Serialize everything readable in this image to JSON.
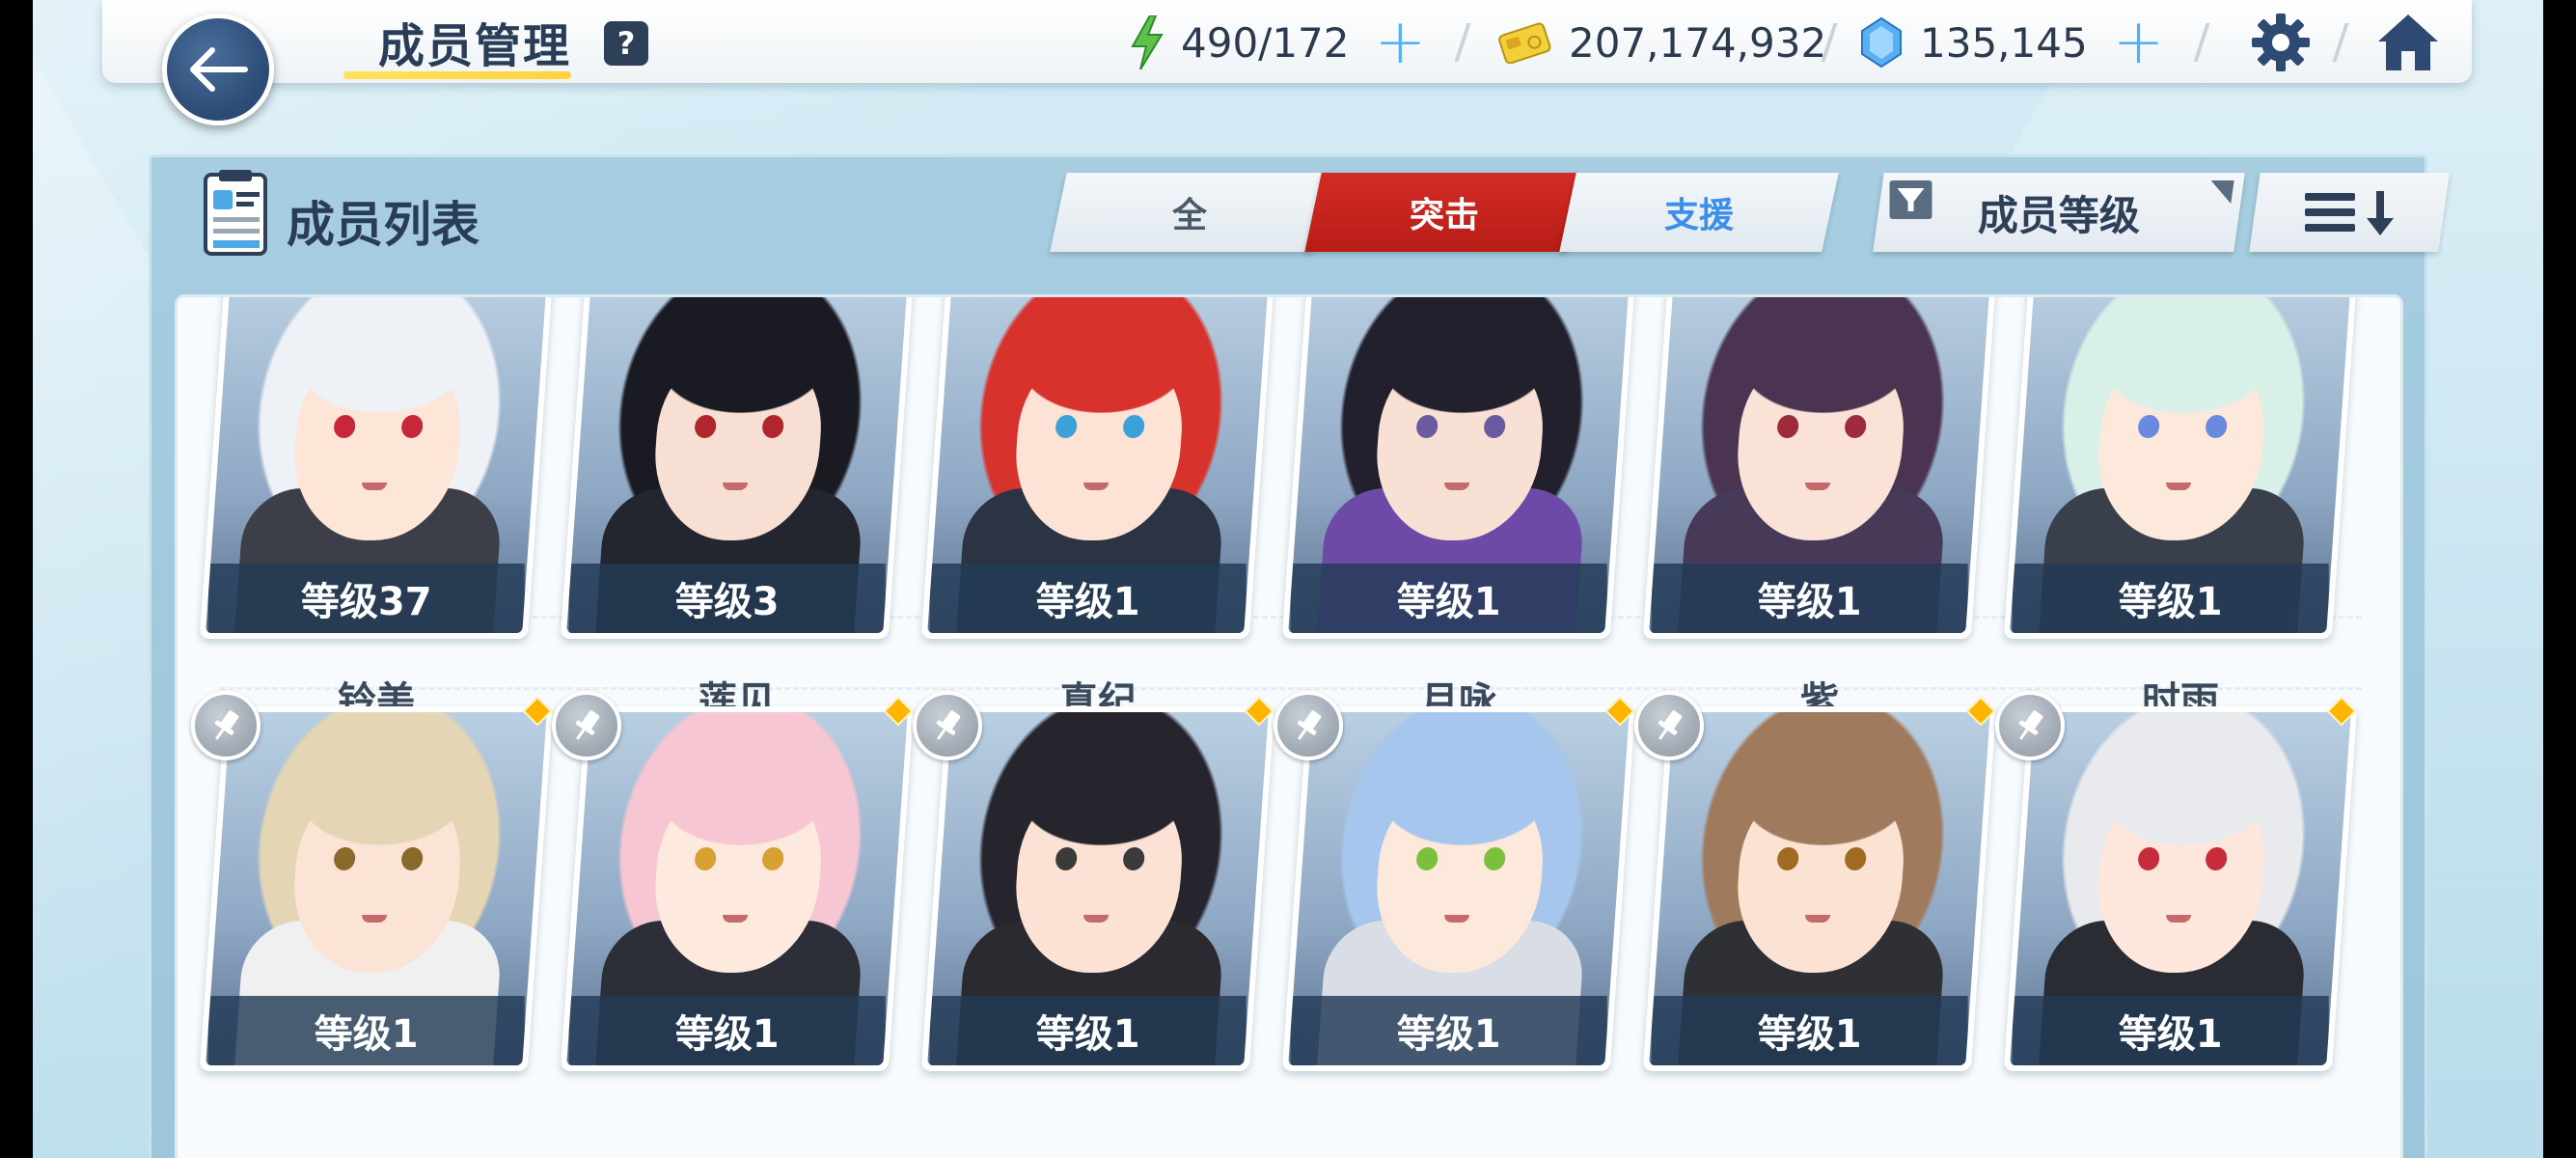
{
  "header": {
    "title": "成员管理",
    "help_label": "?",
    "ap": "490/172",
    "credits": "207,174,932",
    "gems": "135,145",
    "ap_plus": "+",
    "gems_plus": "+"
  },
  "panel": {
    "title": "成员列表",
    "tabs": [
      {
        "label": "全"
      },
      {
        "label": "突击"
      },
      {
        "label": "支援"
      }
    ],
    "sort_label": "成员等级"
  },
  "students": [
    {
      "name": "铃美",
      "level": "等级37",
      "hair": "#eef1f5",
      "skin": "#fde5d8",
      "eye": "#c8263a",
      "outfit": "#3c3f47"
    },
    {
      "name": "莲见",
      "level": "等级3",
      "hair": "#1a1a22",
      "skin": "#f8dfd3",
      "eye": "#b0262c",
      "outfit": "#23262e"
    },
    {
      "name": "真纪",
      "level": "等级1",
      "hair": "#d8322c",
      "skin": "#fde3d5",
      "eye": "#3aa2d8",
      "outfit": "#2c3444"
    },
    {
      "name": "月咏",
      "level": "等级1",
      "hair": "#22202c",
      "skin": "#f8e0d4",
      "eye": "#6a5aa0",
      "outfit": "#6e4aa8"
    },
    {
      "name": "紫",
      "level": "等级1",
      "hair": "#4a3452",
      "skin": "#fbe2d6",
      "eye": "#9c2c3c",
      "outfit": "#463a58"
    },
    {
      "name": "时雨",
      "level": "等级1",
      "hair": "#d8f0e8",
      "skin": "#fde8dc",
      "eye": "#6a8ae0",
      "outfit": "#3a3f4c"
    },
    {
      "name": "",
      "level": "等级1",
      "hair": "#e4d6b4",
      "skin": "#fbe4d6",
      "eye": "#8a6a2a",
      "outfit": "#f0f0f0"
    },
    {
      "name": "",
      "level": "等级1",
      "hair": "#f6c6d2",
      "skin": "#fde9dd",
      "eye": "#d8a030",
      "outfit": "#2c2f38"
    },
    {
      "name": "",
      "level": "等级1",
      "hair": "#26242c",
      "skin": "#fbe2d4",
      "eye": "#3a3a3a",
      "outfit": "#2a2a30"
    },
    {
      "name": "",
      "level": "等级1",
      "hair": "#a6c6ee",
      "skin": "#fde8dc",
      "eye": "#7ac03a",
      "outfit": "#d8dde6"
    },
    {
      "name": "",
      "level": "等级1",
      "hair": "#a07a5c",
      "skin": "#fbe2d2",
      "eye": "#a06a20",
      "outfit": "#2e3036"
    },
    {
      "name": "",
      "level": "等级1",
      "hair": "#e8eaee",
      "skin": "#fde6dc",
      "eye": "#c82c3a",
      "outfit": "#2a2c34"
    }
  ],
  "colors": {
    "accent_red": "#c9241e",
    "support_blue": "#3c8fe8",
    "title_dark": "#2a3d57",
    "pin_gem": "#ffb400"
  },
  "icons": [
    "back-arrow-icon",
    "help-icon",
    "ap-bolt-icon",
    "credit-icon",
    "gem-icon",
    "settings-gear-icon",
    "home-icon",
    "member-list-icon",
    "filter-funnel-icon",
    "sort-order-icon",
    "pin-icon"
  ]
}
